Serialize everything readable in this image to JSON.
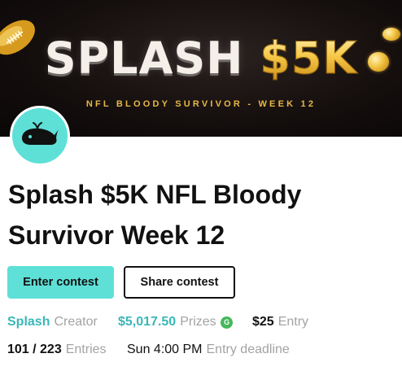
{
  "banner": {
    "title_word1": "SPLASH",
    "title_word2": "$5K",
    "subtitle": "NFL BLOODY SURVIVOR - WEEK 12"
  },
  "contest": {
    "title": "Splash $5K NFL Bloody Survivor Week 12"
  },
  "actions": {
    "enter_label": "Enter contest",
    "share_label": "Share contest"
  },
  "meta": {
    "creator_name": "Splash",
    "creator_label": "Creator",
    "prizes_value": "$5,017.50",
    "prizes_label": "Prizes",
    "prize_badge": "G",
    "entry_fee": "$25",
    "entry_label": "Entry",
    "entries_value": "101 / 223",
    "entries_label": "Entries",
    "deadline_value": "Sun 4:00 PM",
    "deadline_label": "Entry deadline"
  },
  "icons": {
    "avatar": "whale-icon",
    "banner_decoration": "football-icon",
    "prize_badge": "g-badge-icon"
  },
  "colors": {
    "accent": "#5ee0d7",
    "teal_text": "#3ab7b8",
    "banner_gold": "#e8b845",
    "badge_green": "#44b85a",
    "muted": "#a3a3a3"
  }
}
